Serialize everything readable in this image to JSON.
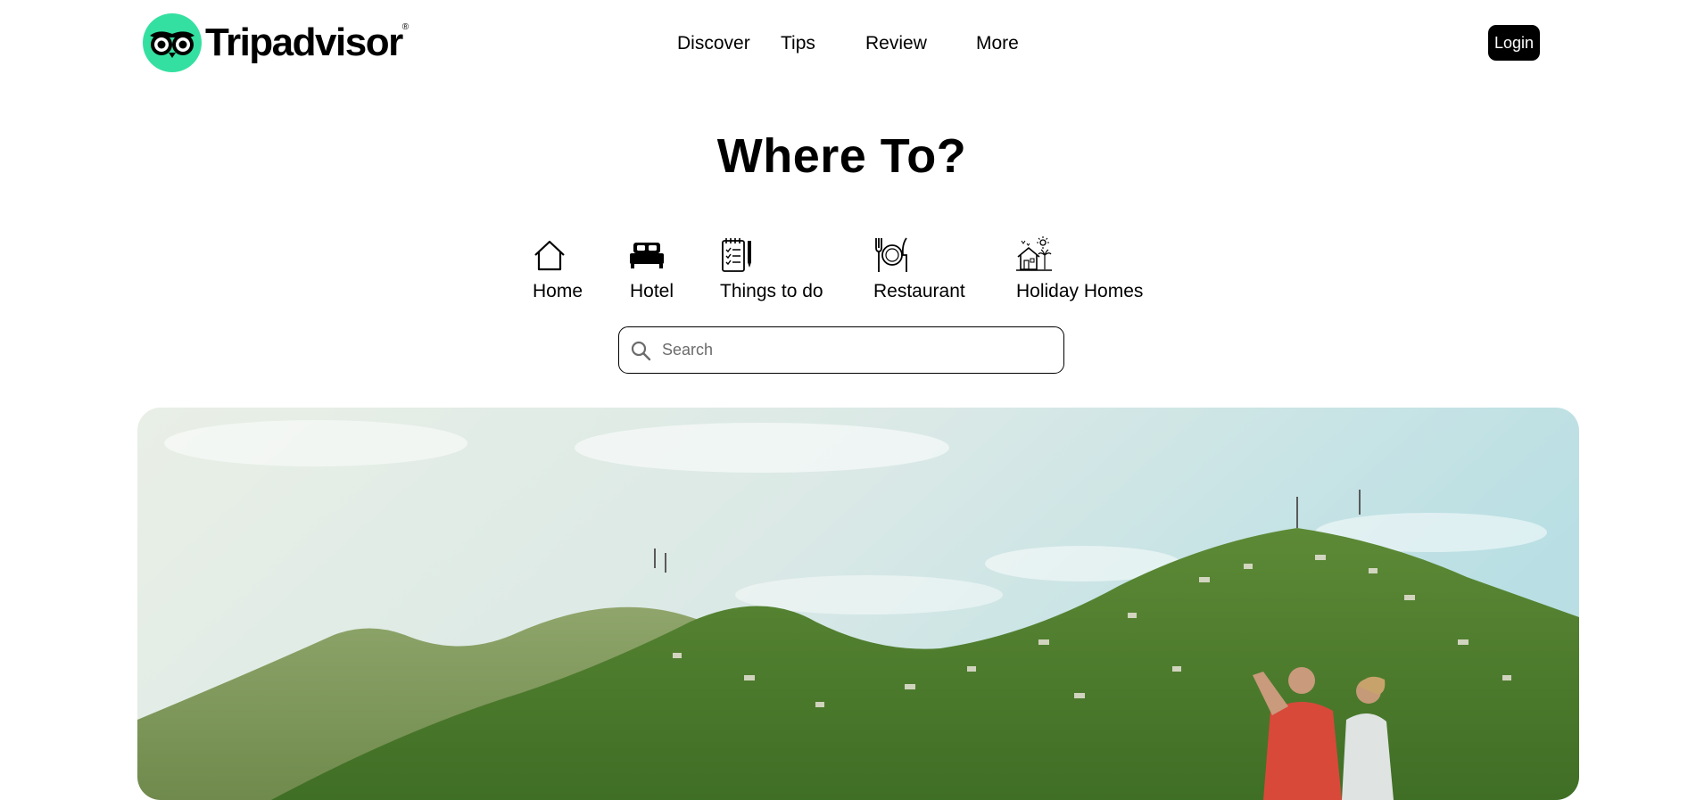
{
  "brand": {
    "name": "Tripadvisor",
    "trademark": "®",
    "accent": "#34e0a1"
  },
  "nav": {
    "items": [
      "Discover",
      "Tips",
      "Review",
      "More"
    ]
  },
  "header": {
    "login_label": "Login"
  },
  "hero": {
    "title": "Where To?"
  },
  "categories": [
    {
      "label": "Home",
      "icon": "house-icon"
    },
    {
      "label": "Hotel",
      "icon": "bed-icon"
    },
    {
      "label": "Things to do",
      "icon": "checklist-icon"
    },
    {
      "label": "Restaurant",
      "icon": "fork-plate-knife-icon"
    },
    {
      "label": "Holiday Homes",
      "icon": "holiday-home-icon"
    }
  ],
  "search": {
    "placeholder": "Search",
    "value": ""
  }
}
